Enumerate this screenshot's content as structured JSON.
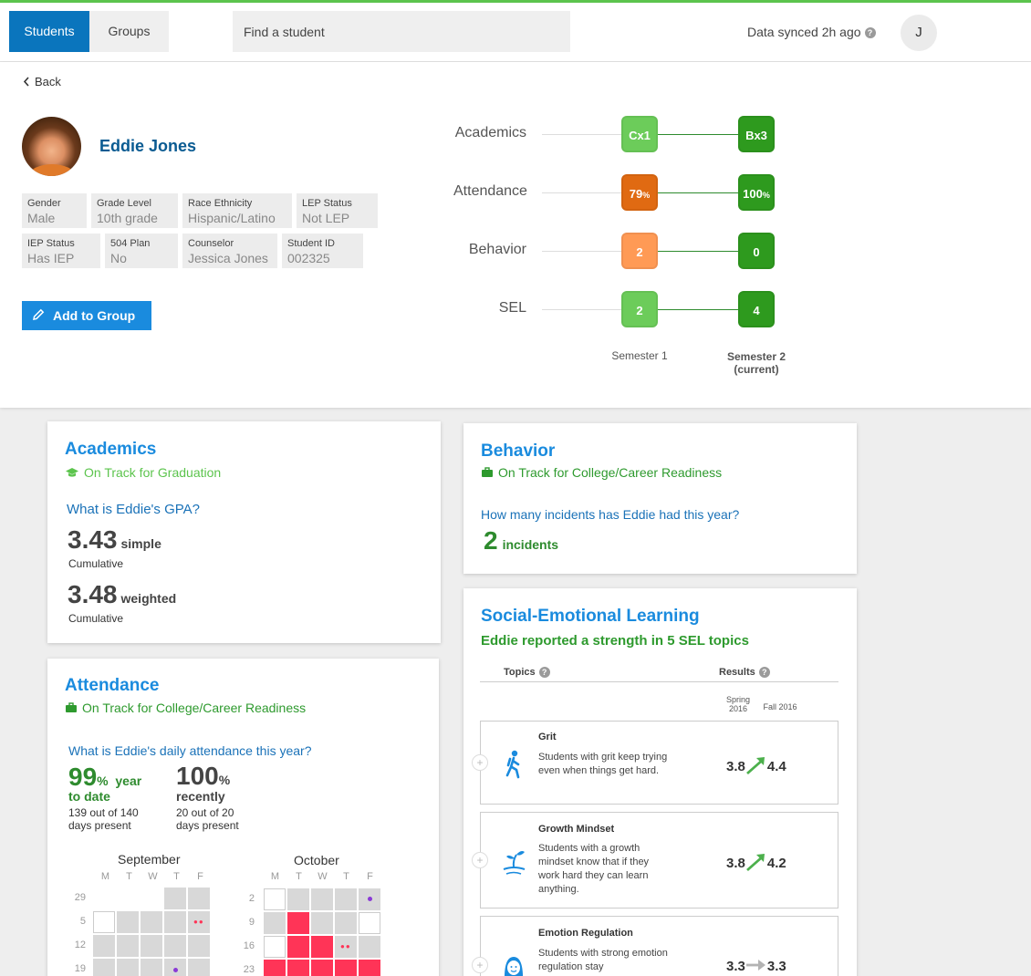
{
  "nav": {
    "tab_students": "Students",
    "tab_groups": "Groups",
    "search_placeholder": "Find a student",
    "sync_status": "Data synced 2h ago",
    "user_initial": "J"
  },
  "profile": {
    "back_label": "Back",
    "name": "Eddie Jones",
    "fields": [
      {
        "label": "Gender",
        "value": "Male"
      },
      {
        "label": "Grade Level",
        "value": "10th grade"
      },
      {
        "label": "Race Ethnicity",
        "value": "Hispanic/Latino"
      },
      {
        "label": "LEP Status",
        "value": "Not LEP"
      },
      {
        "label": "IEP Status",
        "value": "Has IEP"
      },
      {
        "label": "504 Plan",
        "value": "No"
      },
      {
        "label": "Counselor",
        "value": "Jessica Jones"
      },
      {
        "label": "Student ID",
        "value": "002325"
      }
    ],
    "add_to_group_label": "Add to Group"
  },
  "summary": {
    "metrics": [
      {
        "label": "Academics",
        "sem1": "Cx1",
        "sem1_unit": "",
        "sem2": "Bx3",
        "sem2_unit": "",
        "sem1_color": "#6ccc5a",
        "sem2_color": "#2e9a1e"
      },
      {
        "label": "Attendance",
        "sem1": "79",
        "sem1_unit": "%",
        "sem2": "100",
        "sem2_unit": "%",
        "sem1_color": "#e06a12",
        "sem2_color": "#2e9a1e"
      },
      {
        "label": "Behavior",
        "sem1": "2",
        "sem1_unit": "",
        "sem2": "0",
        "sem2_unit": "",
        "sem1_color": "#ff9a55",
        "sem2_color": "#2e9a1e"
      },
      {
        "label": "SEL",
        "sem1": "2",
        "sem1_unit": "",
        "sem2": "4",
        "sem2_unit": "",
        "sem1_color": "#6ccc5a",
        "sem2_color": "#2e9a1e"
      }
    ],
    "semester1_label": "Semester 1",
    "semester2_label": "Semester 2",
    "semester2_note": "(current)"
  },
  "academics": {
    "title": "Academics",
    "status": "On Track for Graduation",
    "question": "What is Eddie's GPA?",
    "gpa_simple": "3.43",
    "gpa_simple_label": "simple",
    "gpa_simple_note": "Cumulative",
    "gpa_weighted": "3.48",
    "gpa_weighted_label": "weighted",
    "gpa_weighted_note": "Cumulative"
  },
  "behavior": {
    "title": "Behavior",
    "status": "On Track for College/Career Readiness",
    "question": "How many incidents has Eddie had this year?",
    "incidents": "2",
    "incidents_label": "incidents"
  },
  "attendance": {
    "title": "Attendance",
    "status": "On Track for College/Career Readiness",
    "question": "What is Eddie's daily attendance this year?",
    "ytd_value": "99",
    "ytd_unit": "%",
    "ytd_label_1": "year",
    "ytd_label_2": "to date",
    "ytd_detail_1": "139 out of 140",
    "ytd_detail_2": "days present",
    "recent_value": "100",
    "recent_unit": "%",
    "recent_label": "recently",
    "recent_detail_1": "20 out of 20",
    "recent_detail_2": "days present",
    "weekdays": [
      "M",
      "T",
      "W",
      "T",
      "F"
    ],
    "months": [
      {
        "name": "September",
        "weeks": [
          "29",
          "5",
          "12",
          "19"
        ]
      },
      {
        "name": "October",
        "weeks": [
          "2",
          "9",
          "16",
          "23"
        ]
      }
    ]
  },
  "sel": {
    "title": "Social-Emotional Learning",
    "summary": "Eddie reported a strength in 5 SEL topics",
    "col_topics": "Topics",
    "col_results": "Results",
    "col_spring_1": "Spring",
    "col_spring_2": "2016",
    "col_fall": "Fall 2016",
    "topics": [
      {
        "name": "Grit",
        "desc": "Students with grit keep trying even when things get hard.",
        "from": "3.8",
        "to": "4.4",
        "trend": "up",
        "icon": "hiker-icon"
      },
      {
        "name": "Growth Mindset",
        "desc": "Students with a growth mindset know that if they work hard they can learn anything.",
        "from": "3.8",
        "to": "4.2",
        "trend": "up",
        "icon": "sprout-icon"
      },
      {
        "name": "Emotion Regulation",
        "desc": "Students with strong emotion regulation stay",
        "from": "3.3",
        "to": "3.3",
        "trend": "flat",
        "icon": "face-icon"
      }
    ]
  },
  "colors": {
    "brand_blue": "#0a75bd",
    "title_blue": "#1a8bde",
    "on_track_green": "#2e9a2e",
    "absent_red": "#ff3457"
  }
}
